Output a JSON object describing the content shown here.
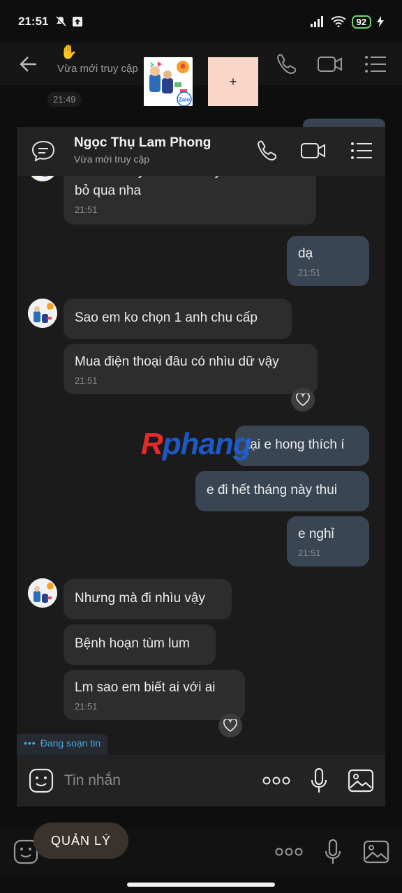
{
  "status_bar": {
    "time": "21:51",
    "battery": "92"
  },
  "background": {
    "last_seen": "Vừa mới truy cập",
    "timestamp": "21:49",
    "manage_button": "QUẢN LÝ"
  },
  "thumbnail": {
    "badge": "Zalo"
  },
  "add_tile": {
    "label": "+"
  },
  "header": {
    "name": "Ngọc Thụ Lam Phong",
    "status": "Vừa mới truy cập"
  },
  "messages": [
    {
      "side": "in",
      "text": "Anh nói hay nếu em thấy ko thích thì bỏ qua nha",
      "time": "21:51"
    },
    {
      "side": "out",
      "text": "dạ",
      "time": "21:51"
    },
    {
      "side": "in",
      "text": "Sao em ko chọn 1 anh chu cấp",
      "time": ""
    },
    {
      "side": "in",
      "text": "Mua điện thoại đâu có nhìu dữ vậy",
      "time": "21:51"
    },
    {
      "side": "out",
      "text": "tại e hong thích í",
      "time": ""
    },
    {
      "side": "out",
      "text": "e đi hết tháng này thui",
      "time": ""
    },
    {
      "side": "out",
      "text": "e nghỉ",
      "time": "21:51"
    },
    {
      "side": "in",
      "text": "Nhưng mà đi nhìu vậy",
      "time": ""
    },
    {
      "side": "in",
      "text": "Bệnh hoạn tùm lum",
      "time": ""
    },
    {
      "side": "in",
      "text": "Lm sao em biết ai với ai",
      "time": "21:51"
    }
  ],
  "typing": {
    "text": "Đang soạn tin"
  },
  "input": {
    "placeholder": "Tin nhắn"
  },
  "watermark": {
    "part1": "R",
    "part2": "phang"
  },
  "colors": {
    "incoming": "#2d2d2d",
    "outgoing": "#3a4553",
    "typing": "#45a6e0"
  }
}
